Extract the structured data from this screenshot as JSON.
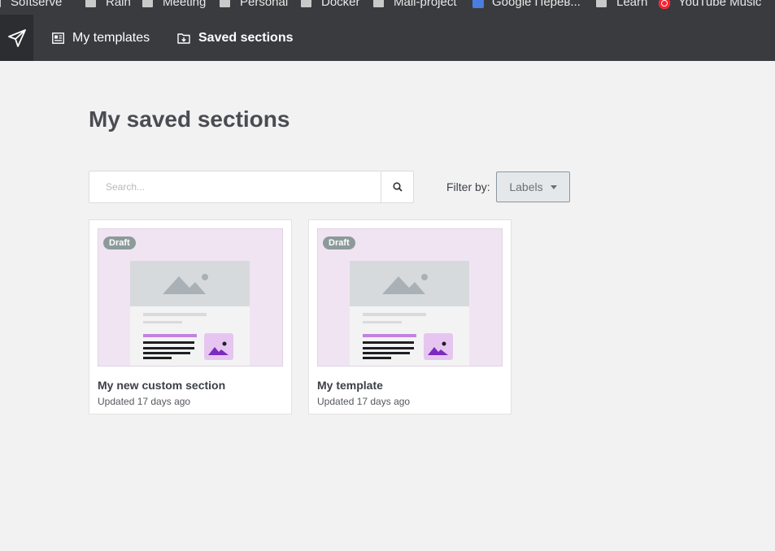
{
  "bookmarks": [
    {
      "label": "Softserve",
      "icon": "folder-icon"
    },
    {
      "label": "Rain",
      "icon": "folder-icon"
    },
    {
      "label": "Meeting",
      "icon": "folder-icon"
    },
    {
      "label": "Personal",
      "icon": "folder-icon"
    },
    {
      "label": "Docker",
      "icon": "folder-icon"
    },
    {
      "label": "Mail-project",
      "icon": "folder-icon"
    },
    {
      "label": "Google Перев...",
      "icon": "google-translate-icon"
    },
    {
      "label": "Learn",
      "icon": "folder-icon"
    },
    {
      "label": "YouTube Music",
      "icon": "youtube-music-icon"
    }
  ],
  "nav": {
    "logo_icon": "paper-plane-icon",
    "items": [
      {
        "label": "My templates",
        "icon": "templates-icon"
      },
      {
        "label": "Saved sections",
        "icon": "saved-folder-icon"
      }
    ]
  },
  "main": {
    "title": "My saved sections",
    "search": {
      "placeholder": "Search...",
      "value": ""
    },
    "filter": {
      "label": "Filter by:",
      "button_label": "Labels"
    }
  },
  "cards": [
    {
      "badge": "Draft",
      "title": "My new custom section",
      "meta": "Updated 17 days ago"
    },
    {
      "badge": "Draft",
      "title": "My template",
      "meta": "Updated 17 days ago"
    }
  ],
  "colors": {
    "nav_bg": "#3a3b3f",
    "page_bg": "#f2f2f2",
    "thumb_bg": "#f0e4f2",
    "accent_purple": "#c084e0",
    "badge_bg": "#8c9a9a"
  }
}
